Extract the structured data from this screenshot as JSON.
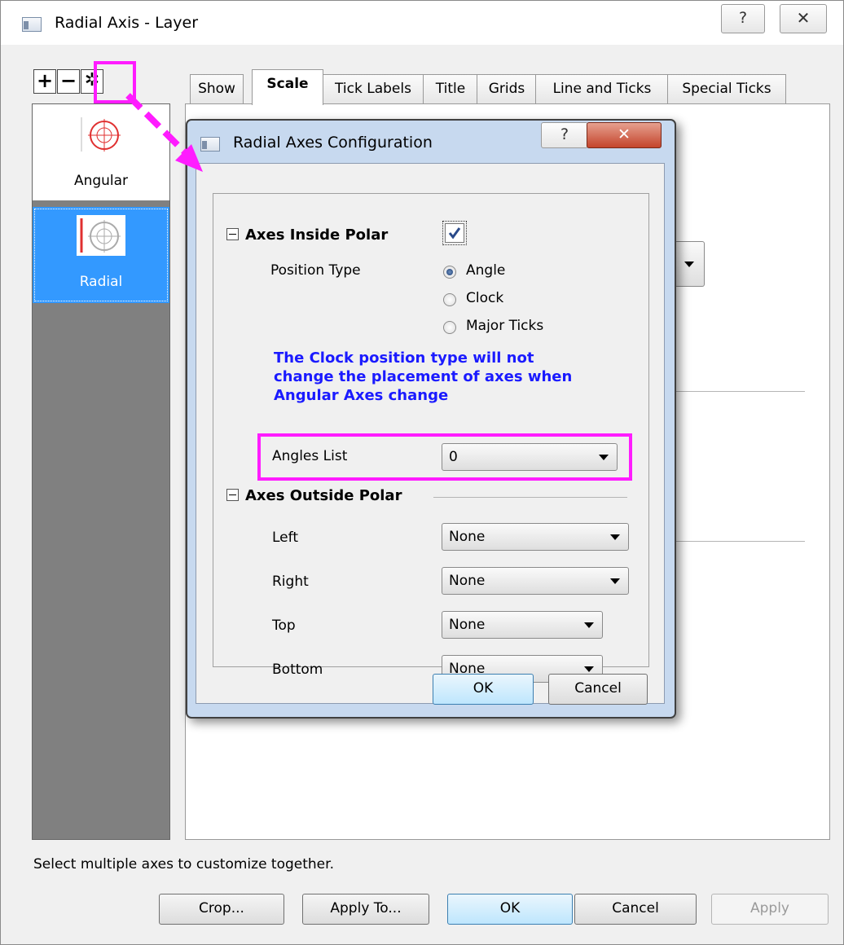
{
  "outer": {
    "title": "Radial Axis - Layer",
    "help_icon": "help-icon",
    "close_icon": "close-icon",
    "toolbar": {
      "add_icon": "plus-icon",
      "remove_icon": "minus-icon",
      "config_icon": "gear-icon"
    },
    "axis_list": [
      {
        "label": "Angular",
        "icon": "angular-axis-icon"
      },
      {
        "label": "Radial",
        "icon": "radial-axis-icon",
        "selected": true
      }
    ],
    "tabs": [
      "Show",
      "Scale",
      "Tick Labels",
      "Title",
      "Grids",
      "Line and Ticks",
      "Special Ticks"
    ],
    "active_tab": "Scale",
    "status_text": "Select multiple axes to customize together.",
    "buttons": {
      "crop": "Crop...",
      "apply_to": "Apply To...",
      "ok": "OK",
      "cancel": "Cancel",
      "apply": "Apply"
    }
  },
  "dialog": {
    "title": "Radial Axes Configuration",
    "inside": {
      "heading": "Axes Inside Polar",
      "checked": true,
      "position_type_label": "Position Type",
      "options": [
        "Angle",
        "Clock",
        "Major Ticks"
      ],
      "selected_option": "Angle",
      "info": [
        "The Clock position type will not",
        "change the placement of axes when",
        "Angular Axes change"
      ],
      "angles_list_label": "Angles List",
      "angles_list_value": "0"
    },
    "outside": {
      "heading": "Axes Outside Polar",
      "rows": [
        {
          "label": "Left",
          "value": "None"
        },
        {
          "label": "Right",
          "value": "None"
        },
        {
          "label": "Top",
          "value": "None"
        },
        {
          "label": "Bottom",
          "value": "None"
        }
      ]
    },
    "ok": "OK",
    "cancel": "Cancel"
  },
  "colors": {
    "highlight": "#ff1cff",
    "info_text": "#1a1aff",
    "selected_item": "#3399ff"
  }
}
